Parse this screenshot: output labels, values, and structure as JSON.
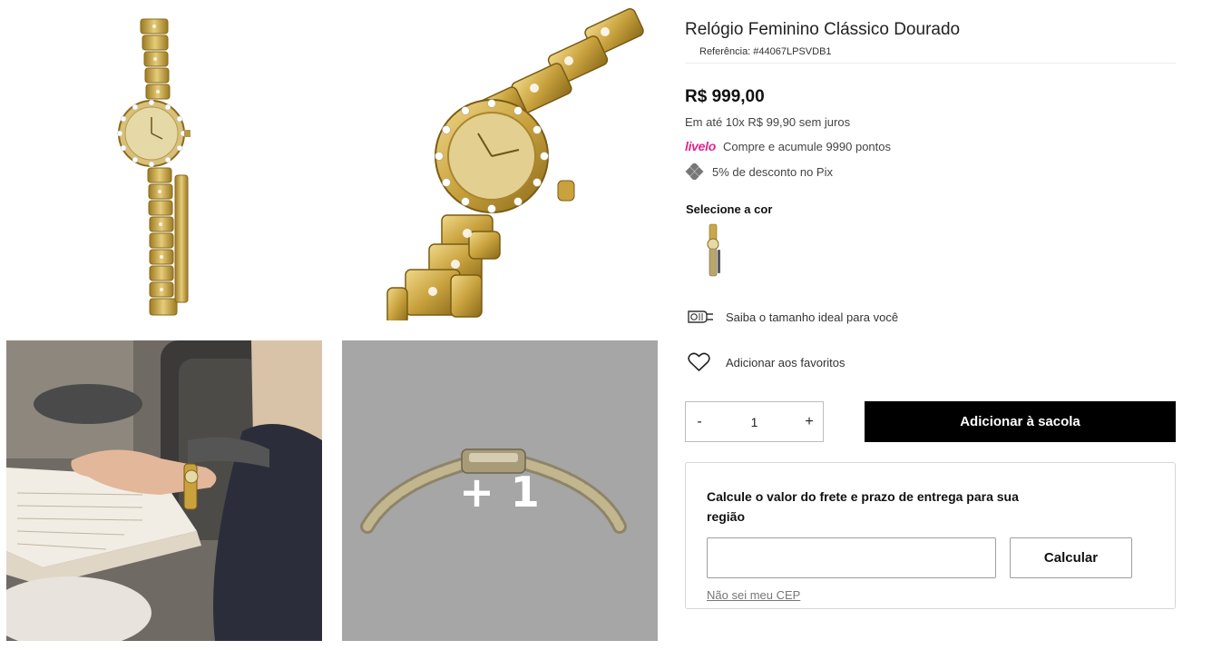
{
  "product": {
    "title": "Relógio Feminino Clássico Dourado",
    "reference": "Referência: #44067LPSVDB1",
    "price": "R$ 999,00",
    "installments": "Em até 10x R$ 99,90 sem juros",
    "livelo_logo": "livelo",
    "livelo_text": "Compre e acumule 9990 pontos",
    "pix_text": "5% de desconto no Pix"
  },
  "color_selector": {
    "label": "Selecione a cor"
  },
  "actions": {
    "size_guide": "Saiba o tamanho ideal para você",
    "favorites": "Adicionar aos favoritos",
    "add_to_bag": "Adicionar à sacola"
  },
  "quantity": {
    "minus": "-",
    "value": "1",
    "plus": "+"
  },
  "freight": {
    "title": "Calcule o valor do frete e prazo de entrega para sua região",
    "cep_placeholder": "",
    "calculate_button": "Calcular",
    "unknown_cep_link": "Não sei meu CEP"
  },
  "gallery": {
    "more_count": "+ 1"
  },
  "colors": {
    "gold": "#c9a74a",
    "gold_dark": "#9c7a22",
    "livelo_pink": "#e0258f",
    "button_black": "#000000"
  }
}
